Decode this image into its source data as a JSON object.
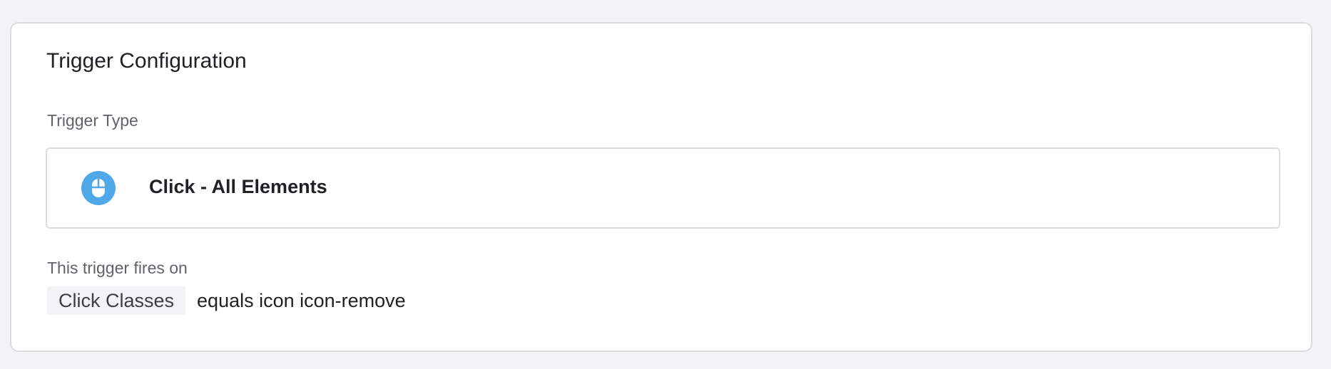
{
  "card": {
    "title": "Trigger Configuration",
    "trigger_type_label": "Trigger Type",
    "trigger_type": {
      "icon": "mouse-icon",
      "name": "Click - All Elements"
    },
    "fires_on_label": "This trigger fires on",
    "condition": {
      "variable": "Click Classes",
      "expression": "equals icon icon-remove"
    }
  },
  "colors": {
    "background": "#f1f3f4",
    "card_border": "#dadce0",
    "icon_accent": "#4fa8e8"
  }
}
